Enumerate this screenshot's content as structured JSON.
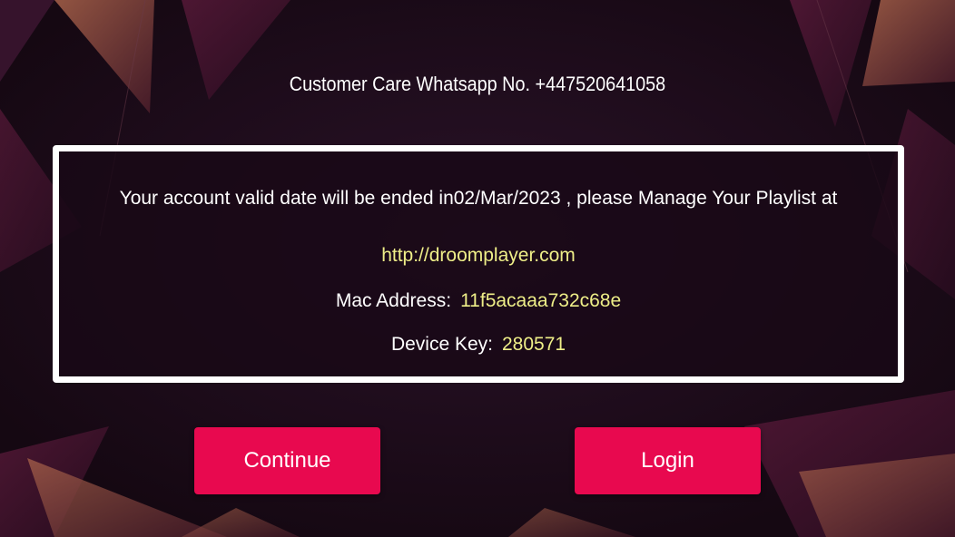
{
  "customer_care": {
    "text": "Customer Care Whatsapp No. +447520641058"
  },
  "account_info": {
    "notice": "Your account valid date will be ended in02/Mar/2023 , please Manage Your Playlist at",
    "url": "http://droomplayer.com",
    "mac_label": "Mac Address:",
    "mac_value": "11f5acaaa732c68e",
    "device_key_label": "Device Key:",
    "device_key_value": "280571"
  },
  "buttons": {
    "continue_label": "Continue",
    "login_label": "Login"
  },
  "colors": {
    "background": "#1e0d1d",
    "accent_button": "#e8094f",
    "highlight_text": "#eeee88",
    "box_border": "#ffffff"
  }
}
